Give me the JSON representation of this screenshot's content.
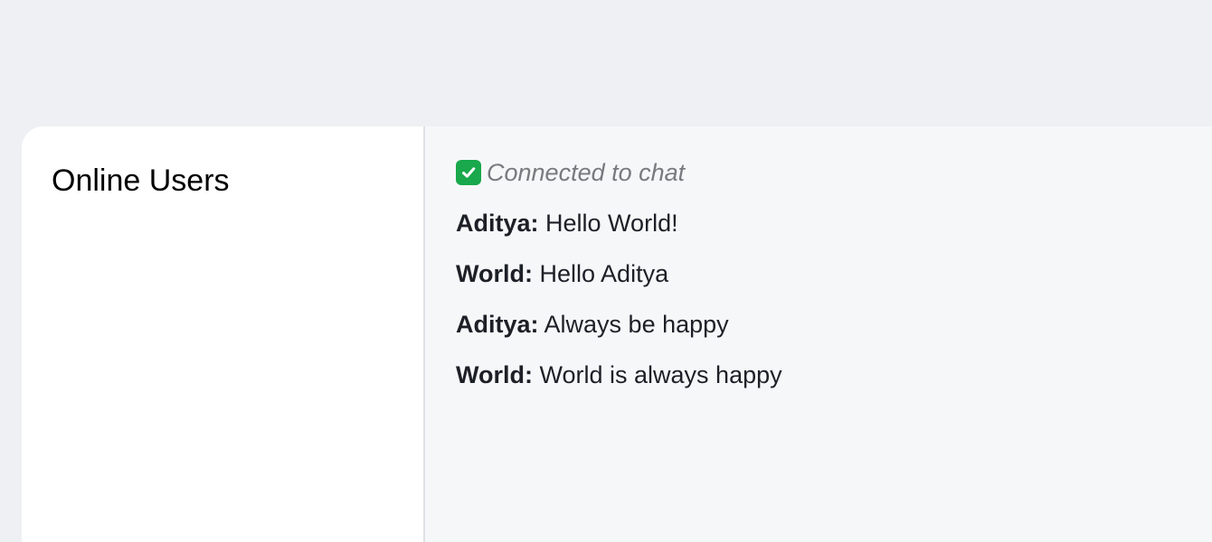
{
  "sidebar": {
    "title": "Online Users"
  },
  "chat": {
    "status_icon": "check-mark-icon",
    "status_text": "Connected to chat",
    "messages": [
      {
        "sender": "Aditya:",
        "text": "Hello World!"
      },
      {
        "sender": "World:",
        "text": "Hello Aditya"
      },
      {
        "sender": "Aditya:",
        "text": "Always be happy"
      },
      {
        "sender": "World:",
        "text": "World is always happy"
      }
    ]
  },
  "colors": {
    "page_background": "#eff0f3",
    "sidebar_background": "#ffffff",
    "chat_background": "#f6f7f9",
    "status_text": "#777a7e",
    "message_text": "#1c2026",
    "check_icon": "#19a84b"
  }
}
